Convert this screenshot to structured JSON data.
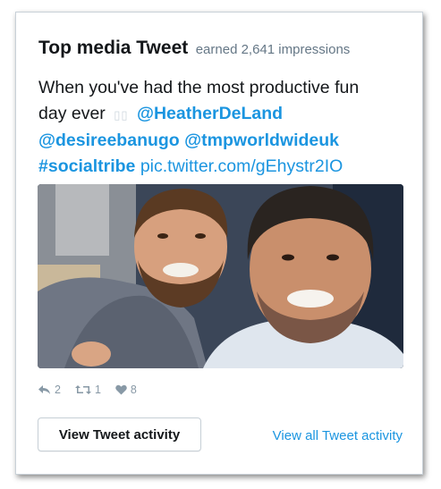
{
  "card": {
    "title": "Top media Tweet",
    "subtitle": "earned 2,641 impressions"
  },
  "tweet": {
    "text_line1": "When you've had the most productive fun",
    "text_day": "day ever",
    "emoji": "▯▯",
    "mention_1": "@HeatherDeLand",
    "mention_2": "@desireebanugo",
    "mention_3": "@tmpworldwideuk",
    "hashtag": "#socialtribe",
    "pic_link": "pic.twitter.com/gEhystr2IO"
  },
  "stats": {
    "replies": "2",
    "retweets": "1",
    "likes": "8"
  },
  "buttons": {
    "view_activity": "View Tweet activity",
    "view_all": "View all Tweet activity"
  },
  "colors": {
    "link": "#1b95e0",
    "text": "#14171a",
    "muted": "#657786",
    "icon": "#8899a6"
  }
}
